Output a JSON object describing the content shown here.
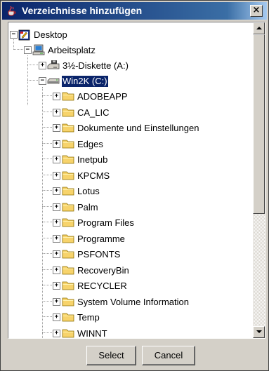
{
  "window": {
    "title": "Verzeichnisse hinzufügen",
    "close_label": "×"
  },
  "tree": {
    "root": {
      "label": "Desktop",
      "icon": "desktop-icon",
      "expander": "−"
    },
    "computer": {
      "label": "Arbeitsplatz",
      "icon": "computer-icon",
      "expander": "−"
    },
    "drives": [
      {
        "label": "3½-Diskette (A:)",
        "icon": "floppy-drive-icon",
        "expander": "+",
        "selected": false
      },
      {
        "label": "Win2K (C:)",
        "icon": "hard-drive-icon",
        "expander": "−",
        "selected": true
      }
    ],
    "folders": [
      {
        "label": "ADOBEAPP",
        "expander": "+"
      },
      {
        "label": "CA_LIC",
        "expander": "+"
      },
      {
        "label": "Dokumente und Einstellungen",
        "expander": "+"
      },
      {
        "label": "Edges",
        "expander": "+"
      },
      {
        "label": "Inetpub",
        "expander": "+"
      },
      {
        "label": "KPCMS",
        "expander": "+"
      },
      {
        "label": "Lotus",
        "expander": "+"
      },
      {
        "label": "Palm",
        "expander": "+"
      },
      {
        "label": "Program Files",
        "expander": "+"
      },
      {
        "label": "Programme",
        "expander": "+"
      },
      {
        "label": "PSFONTS",
        "expander": "+"
      },
      {
        "label": "RecoveryBin",
        "expander": "+"
      },
      {
        "label": "RECYCLER",
        "expander": "+"
      },
      {
        "label": "System Volume Information",
        "expander": "+"
      },
      {
        "label": "Temp",
        "expander": "+"
      },
      {
        "label": "WINNT",
        "expander": "+"
      }
    ]
  },
  "scrollbar": {
    "position": 0.0
  },
  "buttons": {
    "select_label": "Select",
    "cancel_label": "Cancel"
  },
  "colors": {
    "titlebar_start": "#0a246a",
    "titlebar_end": "#a6caf0",
    "selection": "#0a246a",
    "folder": "#f7d36b",
    "window_bg": "#d4d0c8"
  }
}
